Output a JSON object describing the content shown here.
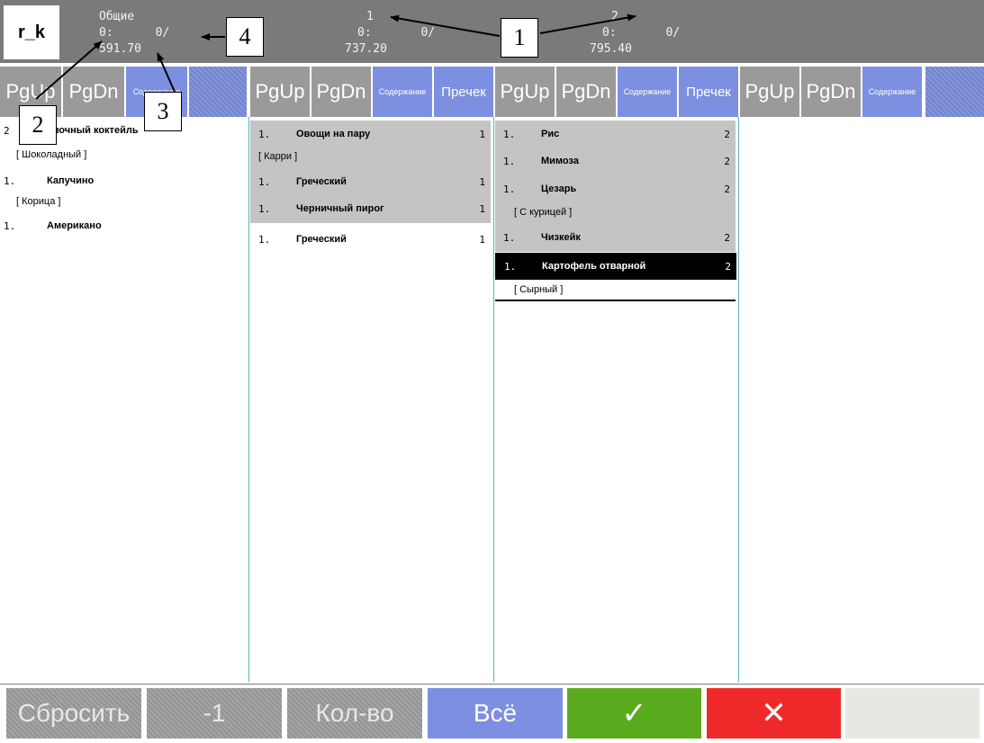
{
  "header": {
    "logo": "r_k",
    "columns": [
      {
        "line1": "Общие",
        "line2": "0:      0/",
        "line3": "591.70"
      },
      {
        "line1": "1",
        "line2": "0:       0/",
        "line3": "737.20"
      },
      {
        "line1": "2",
        "line2": "0:       0/",
        "line3": "795.40"
      }
    ]
  },
  "toolbar": {
    "pgup": "PgUp",
    "pgdn": "PgDn",
    "contents": "Содержание",
    "precheck": "Пречек"
  },
  "columns": [
    {
      "items": [
        {
          "qty": "2",
          "name": "олочный коктейль",
          "count": ""
        },
        {
          "mod": "[ Шоколадный ]"
        },
        {
          "qty": "1.",
          "name": "Капучино",
          "count": ""
        },
        {
          "mod": "[ Корица ]"
        },
        {
          "qty": "1.",
          "name": "Американо",
          "count": ""
        }
      ]
    },
    {
      "items": [
        {
          "qty": "1.",
          "name": "Овощи на пару",
          "count": "1"
        },
        {
          "mod": "[ Карри ]"
        },
        {
          "qty": "1.",
          "name": "Греческий",
          "count": "1"
        },
        {
          "qty": "1.",
          "name": "Черничный пирог",
          "count": "1"
        },
        {
          "qty": "1.",
          "name": "Греческий",
          "count": "1"
        }
      ]
    },
    {
      "items": [
        {
          "qty": "1.",
          "name": "Рис",
          "count": "2"
        },
        {
          "qty": "1.",
          "name": "Мимоза",
          "count": "2"
        },
        {
          "qty": "1.",
          "name": "Цезарь",
          "count": "2"
        },
        {
          "mod": "[ С курицей ]"
        },
        {
          "qty": "1.",
          "name": "Чизкейк",
          "count": "2"
        },
        {
          "qty": "1.",
          "name": "Картофель отварной",
          "count": "2"
        },
        {
          "mod": "[ Сырный ]"
        }
      ]
    }
  ],
  "footer": {
    "reset": "Сбросить",
    "minus_one": "-1",
    "quantity": "Кол-во",
    "all": "Всё",
    "confirm": "✓",
    "cancel": "✕"
  },
  "callouts": [
    "1",
    "2",
    "3",
    "4"
  ],
  "colors": {
    "header_bg": "#7a7a7a",
    "button_gray": "#9a9a9a",
    "button_blue": "#7d8fe0",
    "divider": "#4fb6c4",
    "confirm_green": "#5aaa1e",
    "cancel_red": "#f02a2a",
    "selected_row": "#000000"
  }
}
